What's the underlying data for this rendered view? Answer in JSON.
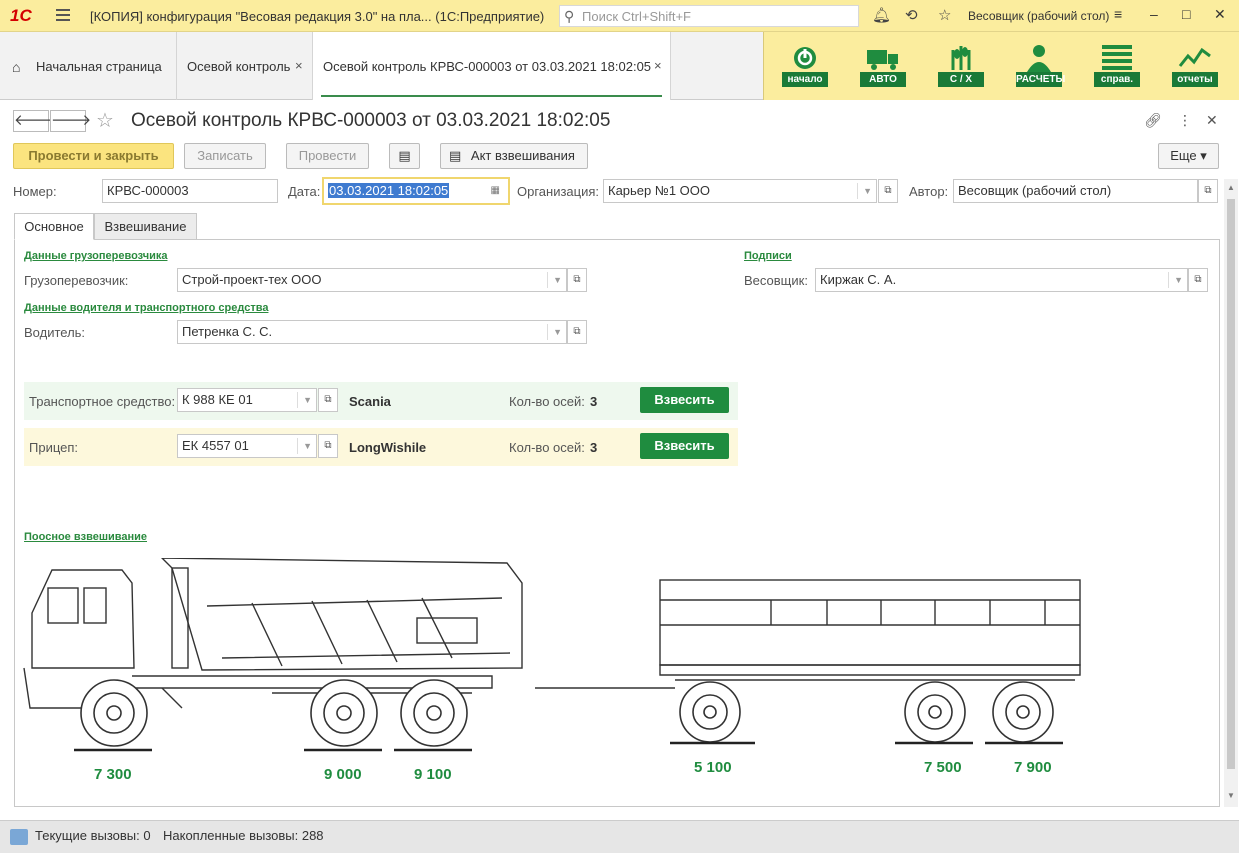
{
  "titlebar": {
    "logo": "1С",
    "app_title": "[КОПИЯ] конфигурация \"Весовая редакция 3.0\" на пла...  (1С:Предприятие)",
    "search_placeholder": "Поиск Ctrl+Shift+F",
    "user": "Весовщик (рабочий стол)"
  },
  "nav_tabs": [
    {
      "label": "Начальная страница"
    },
    {
      "label": "Осевой контроль",
      "close": "×"
    },
    {
      "label": "Осевой контроль КРВС-000003 от 03.03.2021 18:02:05",
      "close": "×"
    }
  ],
  "quick_panel": [
    {
      "label": "начало",
      "icon": "power-icon"
    },
    {
      "label": "АВТО",
      "icon": "truck-icon"
    },
    {
      "label": "С / Х",
      "icon": "wheat-icon"
    },
    {
      "label": "РАСЧЕТЫ",
      "icon": "person-icon"
    },
    {
      "label": "справ.",
      "icon": "list-icon"
    },
    {
      "label": "отчеты",
      "icon": "chart-icon"
    }
  ],
  "document": {
    "title": "Осевой контроль КРВС-000003 от 03.03.2021 18:02:05",
    "buttons": {
      "post_close": "Провести и закрыть",
      "save": "Записать",
      "post": "Провести",
      "act": "Акт взвешивания",
      "more": "Еще"
    },
    "fields": {
      "number_label": "Номер:",
      "number": "КРВС-000003",
      "date_label": "Дата:",
      "date": "03.03.2021 18:02:05",
      "org_label": "Организация:",
      "org": "Карьер №1 ООО",
      "author_label": "Автор:",
      "author": "Весовщик (рабочий стол)"
    },
    "page_tabs": [
      "Основное",
      "Взвешивание"
    ]
  },
  "main": {
    "carrier_section": "Данные грузоперевозчика",
    "carrier_label": "Грузоперевозчик:",
    "carrier": "Строй-проект-тех ООО",
    "driver_section": "Данные водителя и транспортного средства",
    "driver_label": "Водитель:",
    "driver": "Петренка С. С.",
    "signs_section": "Подписи",
    "weigher_label": "Весовщик:",
    "weigher": "Киржак С. А.",
    "vehicle": {
      "label": "Транспортное средство:",
      "plate": "К 988 КЕ 01",
      "model": "Scania",
      "axles_label": "Кол-во осей:",
      "axles": "3",
      "button": "Взвесить"
    },
    "trailer": {
      "label": "Прицеп:",
      "plate": "ЕК 4557 01",
      "model": "LongWishile",
      "axles_label": "Кол-во осей:",
      "axles": "3",
      "button": "Взвесить"
    },
    "axle_section": "Поосное взвешивание",
    "truck_axles": [
      "7 300",
      "9 000",
      "9 100"
    ],
    "trailer_axles": [
      "5 100",
      "7 500",
      "7 900"
    ]
  },
  "status": {
    "current_calls": "Текущие вызовы: 0",
    "accumulated_calls": "Накопленные вызовы: 288"
  }
}
